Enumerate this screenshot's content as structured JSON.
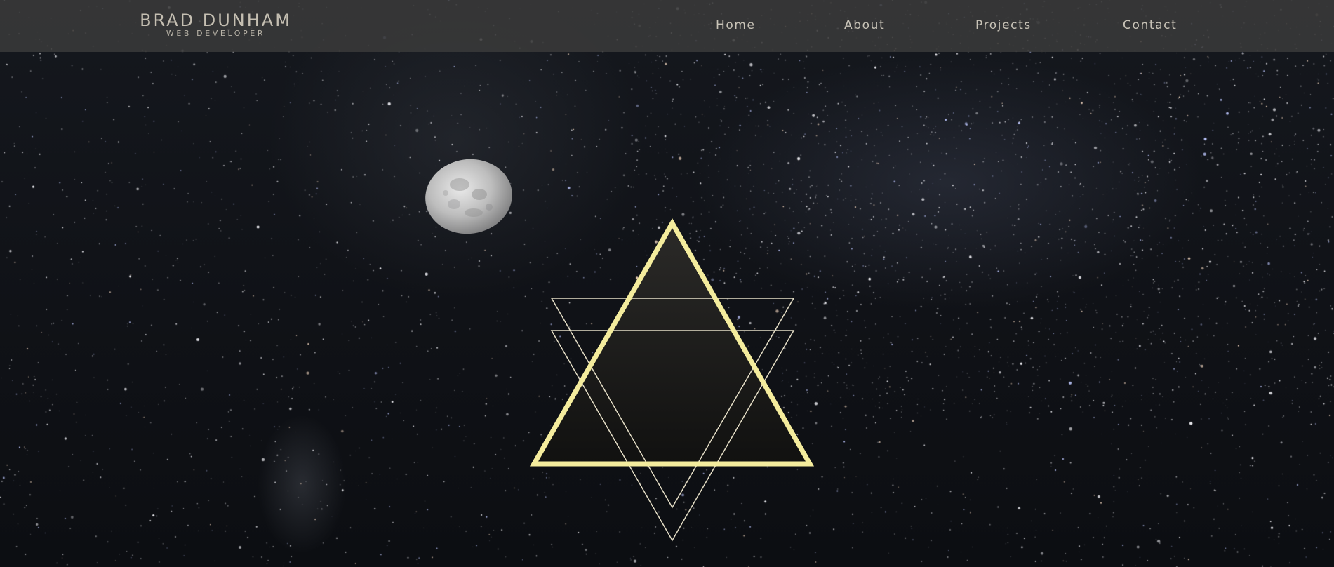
{
  "header": {
    "brand_name": "BRAD DUNHAM",
    "brand_tagline": "WEB DEVELOPER"
  },
  "nav": {
    "items": [
      {
        "label": "Home"
      },
      {
        "label": "About"
      },
      {
        "label": "Projects"
      },
      {
        "label": "Contact"
      }
    ]
  },
  "icons": {
    "moon": "moon-image",
    "emblem": "triangle-emblem-icon"
  },
  "colors": {
    "header_background": "#3a3a3a",
    "text_muted": "#c9c4b8",
    "emblem_accent": "#f4ec9d",
    "emblem_thin": "#e6dfc7",
    "sky": "#101217"
  }
}
